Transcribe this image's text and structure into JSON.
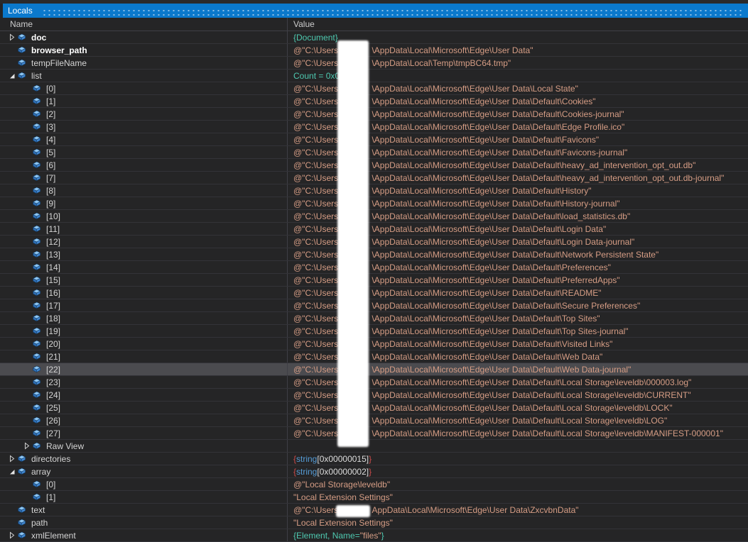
{
  "window": {
    "title": "Locals"
  },
  "columns": {
    "name": "Name",
    "value": "Value"
  },
  "colors": {
    "titlebar_blue": "#0b79cc",
    "background": "#252526",
    "string_value": "#d69d85",
    "object_value_teal": "#4ec9b0",
    "brace_red": "#cd4a4a",
    "type_blue": "#569cd6",
    "selected_row": "#4b4b4f",
    "redaction": "#ffffff"
  },
  "icons": {
    "field_icon": "blue-3d-box",
    "collapsed_icon": "hollow-right-triangle",
    "expanded_icon": "filled-corner-triangle"
  },
  "rows": [
    {
      "name": "doc",
      "level": 0,
      "arrow": "collapsed",
      "bold": true,
      "selected": false,
      "value": [
        {
          "t": "{Document}",
          "c": "teal"
        }
      ]
    },
    {
      "name": "browser_path",
      "level": 0,
      "arrow": "none",
      "bold": true,
      "selected": false,
      "value": [
        {
          "t": "@\"C:\\Users\\",
          "c": "str"
        },
        {
          "t": "",
          "c": "gap"
        },
        {
          "t": "\\AppData\\Local\\Microsoft\\Edge\\User Data\"",
          "c": "str"
        }
      ]
    },
    {
      "name": "tempFileName",
      "level": 0,
      "arrow": "none",
      "bold": false,
      "selected": false,
      "value": [
        {
          "t": "@\"C:\\Users\\",
          "c": "str"
        },
        {
          "t": "",
          "c": "gap"
        },
        {
          "t": "\\AppData\\Local\\Temp\\tmpBC64.tmp\"",
          "c": "str"
        }
      ]
    },
    {
      "name": "list",
      "level": 0,
      "arrow": "expanded",
      "bold": false,
      "selected": false,
      "value": [
        {
          "t": "Count = 0x0",
          "c": "teal"
        }
      ]
    },
    {
      "name": "[0]",
      "level": 1,
      "arrow": "none",
      "bold": false,
      "selected": false,
      "value": [
        {
          "t": "@\"C:\\Users\\",
          "c": "str"
        },
        {
          "t": "",
          "c": "gap"
        },
        {
          "t": "\\AppData\\Local\\Microsoft\\Edge\\User Data\\Local State\"",
          "c": "str"
        }
      ]
    },
    {
      "name": "[1]",
      "level": 1,
      "arrow": "none",
      "bold": false,
      "selected": false,
      "value": [
        {
          "t": "@\"C:\\Users\\",
          "c": "str"
        },
        {
          "t": "",
          "c": "gap"
        },
        {
          "t": "\\AppData\\Local\\Microsoft\\Edge\\User Data\\Default\\Cookies\"",
          "c": "str"
        }
      ]
    },
    {
      "name": "[2]",
      "level": 1,
      "arrow": "none",
      "bold": false,
      "selected": false,
      "value": [
        {
          "t": "@\"C:\\Users\\",
          "c": "str"
        },
        {
          "t": "",
          "c": "gap"
        },
        {
          "t": "\\AppData\\Local\\Microsoft\\Edge\\User Data\\Default\\Cookies-journal\"",
          "c": "str"
        }
      ]
    },
    {
      "name": "[3]",
      "level": 1,
      "arrow": "none",
      "bold": false,
      "selected": false,
      "value": [
        {
          "t": "@\"C:\\Users\\",
          "c": "str"
        },
        {
          "t": "",
          "c": "gap"
        },
        {
          "t": "\\AppData\\Local\\Microsoft\\Edge\\User Data\\Default\\Edge Profile.ico\"",
          "c": "str"
        }
      ]
    },
    {
      "name": "[4]",
      "level": 1,
      "arrow": "none",
      "bold": false,
      "selected": false,
      "value": [
        {
          "t": "@\"C:\\Users\\",
          "c": "str"
        },
        {
          "t": "",
          "c": "gap"
        },
        {
          "t": "\\AppData\\Local\\Microsoft\\Edge\\User Data\\Default\\Favicons\"",
          "c": "str"
        }
      ]
    },
    {
      "name": "[5]",
      "level": 1,
      "arrow": "none",
      "bold": false,
      "selected": false,
      "value": [
        {
          "t": "@\"C:\\Users\\",
          "c": "str"
        },
        {
          "t": "",
          "c": "gap"
        },
        {
          "t": "\\AppData\\Local\\Microsoft\\Edge\\User Data\\Default\\Favicons-journal\"",
          "c": "str"
        }
      ]
    },
    {
      "name": "[6]",
      "level": 1,
      "arrow": "none",
      "bold": false,
      "selected": false,
      "value": [
        {
          "t": "@\"C:\\Users\\",
          "c": "str"
        },
        {
          "t": "",
          "c": "gap"
        },
        {
          "t": "\\AppData\\Local\\Microsoft\\Edge\\User Data\\Default\\heavy_ad_intervention_opt_out.db\"",
          "c": "str"
        }
      ]
    },
    {
      "name": "[7]",
      "level": 1,
      "arrow": "none",
      "bold": false,
      "selected": false,
      "value": [
        {
          "t": "@\"C:\\Users\\",
          "c": "str"
        },
        {
          "t": "",
          "c": "gap"
        },
        {
          "t": "\\AppData\\Local\\Microsoft\\Edge\\User Data\\Default\\heavy_ad_intervention_opt_out.db-journal\"",
          "c": "str"
        }
      ]
    },
    {
      "name": "[8]",
      "level": 1,
      "arrow": "none",
      "bold": false,
      "selected": false,
      "value": [
        {
          "t": "@\"C:\\Users\\",
          "c": "str"
        },
        {
          "t": "",
          "c": "gap"
        },
        {
          "t": "\\AppData\\Local\\Microsoft\\Edge\\User Data\\Default\\History\"",
          "c": "str"
        }
      ]
    },
    {
      "name": "[9]",
      "level": 1,
      "arrow": "none",
      "bold": false,
      "selected": false,
      "value": [
        {
          "t": "@\"C:\\Users\\",
          "c": "str"
        },
        {
          "t": "",
          "c": "gap"
        },
        {
          "t": "\\AppData\\Local\\Microsoft\\Edge\\User Data\\Default\\History-journal\"",
          "c": "str"
        }
      ]
    },
    {
      "name": "[10]",
      "level": 1,
      "arrow": "none",
      "bold": false,
      "selected": false,
      "value": [
        {
          "t": "@\"C:\\Users\\",
          "c": "str"
        },
        {
          "t": "",
          "c": "gap"
        },
        {
          "t": "\\AppData\\Local\\Microsoft\\Edge\\User Data\\Default\\load_statistics.db\"",
          "c": "str"
        }
      ]
    },
    {
      "name": "[11]",
      "level": 1,
      "arrow": "none",
      "bold": false,
      "selected": false,
      "value": [
        {
          "t": "@\"C:\\Users\\",
          "c": "str"
        },
        {
          "t": "",
          "c": "gap"
        },
        {
          "t": "\\AppData\\Local\\Microsoft\\Edge\\User Data\\Default\\Login Data\"",
          "c": "str"
        }
      ]
    },
    {
      "name": "[12]",
      "level": 1,
      "arrow": "none",
      "bold": false,
      "selected": false,
      "value": [
        {
          "t": "@\"C:\\Users\\",
          "c": "str"
        },
        {
          "t": "",
          "c": "gap"
        },
        {
          "t": "\\AppData\\Local\\Microsoft\\Edge\\User Data\\Default\\Login Data-journal\"",
          "c": "str"
        }
      ]
    },
    {
      "name": "[13]",
      "level": 1,
      "arrow": "none",
      "bold": false,
      "selected": false,
      "value": [
        {
          "t": "@\"C:\\Users\\",
          "c": "str"
        },
        {
          "t": "",
          "c": "gap"
        },
        {
          "t": "\\AppData\\Local\\Microsoft\\Edge\\User Data\\Default\\Network Persistent State\"",
          "c": "str"
        }
      ]
    },
    {
      "name": "[14]",
      "level": 1,
      "arrow": "none",
      "bold": false,
      "selected": false,
      "value": [
        {
          "t": "@\"C:\\Users\\",
          "c": "str"
        },
        {
          "t": "",
          "c": "gap"
        },
        {
          "t": "\\AppData\\Local\\Microsoft\\Edge\\User Data\\Default\\Preferences\"",
          "c": "str"
        }
      ]
    },
    {
      "name": "[15]",
      "level": 1,
      "arrow": "none",
      "bold": false,
      "selected": false,
      "value": [
        {
          "t": "@\"C:\\Users\\",
          "c": "str"
        },
        {
          "t": "",
          "c": "gap"
        },
        {
          "t": "\\AppData\\Local\\Microsoft\\Edge\\User Data\\Default\\PreferredApps\"",
          "c": "str"
        }
      ]
    },
    {
      "name": "[16]",
      "level": 1,
      "arrow": "none",
      "bold": false,
      "selected": false,
      "value": [
        {
          "t": "@\"C:\\Users\\",
          "c": "str"
        },
        {
          "t": "",
          "c": "gap"
        },
        {
          "t": "\\AppData\\Local\\Microsoft\\Edge\\User Data\\Default\\README\"",
          "c": "str"
        }
      ]
    },
    {
      "name": "[17]",
      "level": 1,
      "arrow": "none",
      "bold": false,
      "selected": false,
      "value": [
        {
          "t": "@\"C:\\Users\\",
          "c": "str"
        },
        {
          "t": "",
          "c": "gap"
        },
        {
          "t": "\\AppData\\Local\\Microsoft\\Edge\\User Data\\Default\\Secure Preferences\"",
          "c": "str"
        }
      ]
    },
    {
      "name": "[18]",
      "level": 1,
      "arrow": "none",
      "bold": false,
      "selected": false,
      "value": [
        {
          "t": "@\"C:\\Users\\",
          "c": "str"
        },
        {
          "t": "",
          "c": "gap"
        },
        {
          "t": "\\AppData\\Local\\Microsoft\\Edge\\User Data\\Default\\Top Sites\"",
          "c": "str"
        }
      ]
    },
    {
      "name": "[19]",
      "level": 1,
      "arrow": "none",
      "bold": false,
      "selected": false,
      "value": [
        {
          "t": "@\"C:\\Users\\",
          "c": "str"
        },
        {
          "t": "",
          "c": "gap"
        },
        {
          "t": "\\AppData\\Local\\Microsoft\\Edge\\User Data\\Default\\Top Sites-journal\"",
          "c": "str"
        }
      ]
    },
    {
      "name": "[20]",
      "level": 1,
      "arrow": "none",
      "bold": false,
      "selected": false,
      "value": [
        {
          "t": "@\"C:\\Users\\",
          "c": "str"
        },
        {
          "t": "",
          "c": "gap"
        },
        {
          "t": "\\AppData\\Local\\Microsoft\\Edge\\User Data\\Default\\Visited Links\"",
          "c": "str"
        }
      ]
    },
    {
      "name": "[21]",
      "level": 1,
      "arrow": "none",
      "bold": false,
      "selected": false,
      "value": [
        {
          "t": "@\"C:\\Users\\",
          "c": "str"
        },
        {
          "t": "",
          "c": "gap"
        },
        {
          "t": "\\AppData\\Local\\Microsoft\\Edge\\User Data\\Default\\Web Data\"",
          "c": "str"
        }
      ]
    },
    {
      "name": "[22]",
      "level": 1,
      "arrow": "none",
      "bold": false,
      "selected": true,
      "value": [
        {
          "t": "@\"C:\\Users\\",
          "c": "str"
        },
        {
          "t": "",
          "c": "gap"
        },
        {
          "t": "\\AppData\\Local\\Microsoft\\Edge\\User Data\\Default\\Web Data-journal\"",
          "c": "str"
        }
      ]
    },
    {
      "name": "[23]",
      "level": 1,
      "arrow": "none",
      "bold": false,
      "selected": false,
      "value": [
        {
          "t": "@\"C:\\Users\\",
          "c": "str"
        },
        {
          "t": "",
          "c": "gap"
        },
        {
          "t": "\\AppData\\Local\\Microsoft\\Edge\\User Data\\Default\\Local Storage\\leveldb\\000003.log\"",
          "c": "str"
        }
      ]
    },
    {
      "name": "[24]",
      "level": 1,
      "arrow": "none",
      "bold": false,
      "selected": false,
      "value": [
        {
          "t": "@\"C:\\Users\\",
          "c": "str"
        },
        {
          "t": "",
          "c": "gap"
        },
        {
          "t": "\\AppData\\Local\\Microsoft\\Edge\\User Data\\Default\\Local Storage\\leveldb\\CURRENT\"",
          "c": "str"
        }
      ]
    },
    {
      "name": "[25]",
      "level": 1,
      "arrow": "none",
      "bold": false,
      "selected": false,
      "value": [
        {
          "t": "@\"C:\\Users\\",
          "c": "str"
        },
        {
          "t": "",
          "c": "gap"
        },
        {
          "t": "\\AppData\\Local\\Microsoft\\Edge\\User Data\\Default\\Local Storage\\leveldb\\LOCK\"",
          "c": "str"
        }
      ]
    },
    {
      "name": "[26]",
      "level": 1,
      "arrow": "none",
      "bold": false,
      "selected": false,
      "value": [
        {
          "t": "@\"C:\\Users\\",
          "c": "str"
        },
        {
          "t": "",
          "c": "gap"
        },
        {
          "t": "\\AppData\\Local\\Microsoft\\Edge\\User Data\\Default\\Local Storage\\leveldb\\LOG\"",
          "c": "str"
        }
      ]
    },
    {
      "name": "[27]",
      "level": 1,
      "arrow": "none",
      "bold": false,
      "selected": false,
      "value": [
        {
          "t": "@\"C:\\Users\\",
          "c": "str"
        },
        {
          "t": "",
          "c": "gap"
        },
        {
          "t": "\\AppData\\Local\\Microsoft\\Edge\\User Data\\Default\\Local Storage\\leveldb\\MANIFEST-000001\"",
          "c": "str"
        }
      ]
    },
    {
      "name": "Raw View",
      "level": 1,
      "arrow": "collapsed",
      "bold": false,
      "selected": false,
      "value": []
    },
    {
      "name": "directories",
      "level": 0,
      "arrow": "collapsed",
      "bold": false,
      "selected": false,
      "value": [
        {
          "t": "{",
          "c": "red"
        },
        {
          "t": "string",
          "c": "blue"
        },
        {
          "t": "[0x00000015]",
          "c": "white"
        },
        {
          "t": "}",
          "c": "red"
        }
      ]
    },
    {
      "name": "array",
      "level": 0,
      "arrow": "expanded",
      "bold": false,
      "selected": false,
      "value": [
        {
          "t": "{",
          "c": "red"
        },
        {
          "t": "string",
          "c": "blue"
        },
        {
          "t": "[0x00000002]",
          "c": "white"
        },
        {
          "t": "}",
          "c": "red"
        }
      ]
    },
    {
      "name": "[0]",
      "level": 1,
      "arrow": "none",
      "bold": false,
      "selected": false,
      "value": [
        {
          "t": "@\"Local Storage\\leveldb\"",
          "c": "str"
        }
      ]
    },
    {
      "name": "[1]",
      "level": 1,
      "arrow": "none",
      "bold": false,
      "selected": false,
      "value": [
        {
          "t": "\"Local Extension Settings\"",
          "c": "str"
        }
      ]
    },
    {
      "name": "text",
      "level": 0,
      "arrow": "none",
      "bold": false,
      "selected": false,
      "value": [
        {
          "t": "@\"C:\\Users\\",
          "c": "str"
        },
        {
          "t": "",
          "c": "gap"
        },
        {
          "t": "AppData\\Local\\Microsoft\\Edge\\User Data\\ZxcvbnData\"",
          "c": "str"
        }
      ]
    },
    {
      "name": "path",
      "level": 0,
      "arrow": "none",
      "bold": false,
      "selected": false,
      "value": [
        {
          "t": "\"Local Extension Settings\"",
          "c": "str"
        }
      ]
    },
    {
      "name": "xmlElement",
      "level": 0,
      "arrow": "collapsed",
      "bold": false,
      "selected": false,
      "value": [
        {
          "t": "{Element, Name=",
          "c": "teal"
        },
        {
          "t": "\"files\"",
          "c": "str"
        },
        {
          "t": "}",
          "c": "teal"
        }
      ]
    }
  ]
}
